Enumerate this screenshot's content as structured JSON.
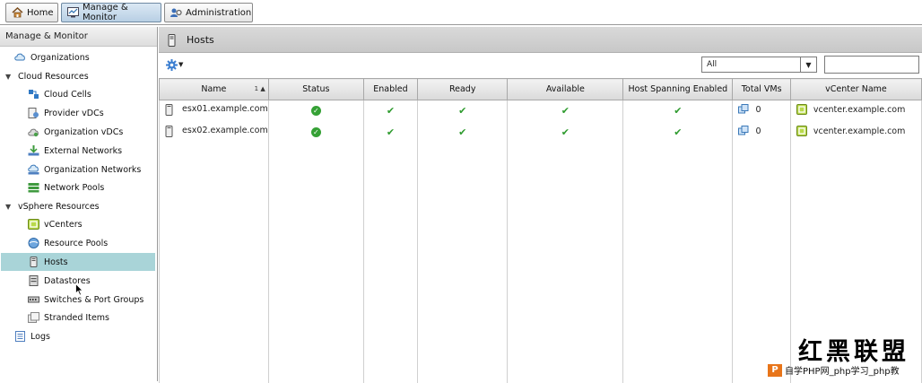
{
  "top_tabs": [
    {
      "label": "Home",
      "icon": "home-icon"
    },
    {
      "label": "Manage & Monitor",
      "icon": "monitor-icon",
      "active": true
    },
    {
      "label": "Administration",
      "icon": "admin-icon"
    }
  ],
  "sidebar": {
    "header": "Manage & Monitor",
    "organizations": "Organizations",
    "cloud_resources": {
      "label": "Cloud Resources",
      "items": [
        "Cloud Cells",
        "Provider vDCs",
        "Organization vDCs",
        "External Networks",
        "Organization Networks",
        "Network Pools"
      ]
    },
    "vsphere_resources": {
      "label": "vSphere Resources",
      "items": [
        "vCenters",
        "Resource Pools",
        "Hosts",
        "Datastores",
        "Switches & Port Groups",
        "Stranded Items"
      ]
    },
    "logs": "Logs",
    "selected": "Hosts"
  },
  "main": {
    "title": "Hosts",
    "filter": {
      "value": "All"
    },
    "search": {
      "value": ""
    },
    "columns": [
      "Name",
      "Status",
      "Enabled",
      "Ready",
      "Available",
      "Host Spanning Enabled",
      "Total VMs",
      "vCenter Name"
    ],
    "sort_indicator": "1",
    "rows": [
      {
        "name": "esx01.example.com",
        "total_vms": "0",
        "vcenter": "vcenter.example.com"
      },
      {
        "name": "esx02.example.com",
        "total_vms": "0",
        "vcenter": "vcenter.example.com"
      }
    ]
  },
  "watermark": {
    "title": "红黑联盟",
    "subtitle": "自学PHP网_php学习_php教"
  },
  "colors": {
    "selection": "#a9d4d8",
    "status_ok": "#35a135",
    "header_bg": "#d9d9d9",
    "accent_orange": "#e8751a"
  }
}
